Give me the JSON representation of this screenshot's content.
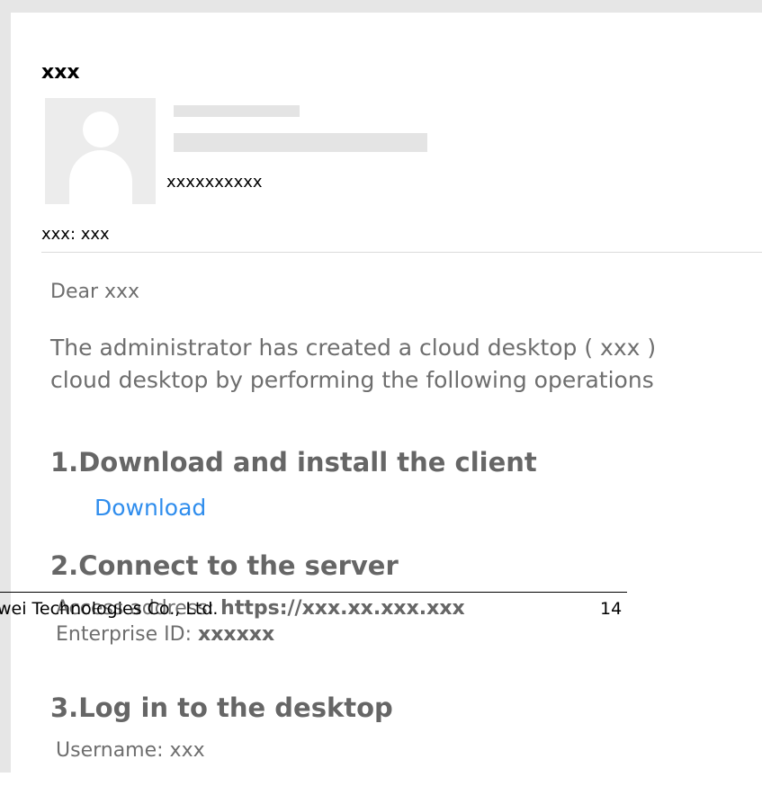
{
  "email": {
    "subject": "xxx",
    "sender": "xxxxxxxxxx",
    "to": "xxx: xxx",
    "greeting": "Dear xxx",
    "intro_line1": "The administrator has created a cloud desktop ( xxx )",
    "intro_line2": "cloud desktop by performing the following operations",
    "step1_heading": "1.Download and install the client",
    "download_link": "Download",
    "step2_heading": "2.Connect to the server",
    "access_label": "Access address:",
    "access_value": "https://xxx.xx.xxx.xxx",
    "enterprise_label": "Enterprise ID:",
    "enterprise_value": "xxxxxx",
    "step3_heading": "3.Log in to the desktop",
    "username": "Username: xxx"
  },
  "footer": {
    "company": "wei Technologies Co., Ltd.",
    "page_number": "14"
  }
}
